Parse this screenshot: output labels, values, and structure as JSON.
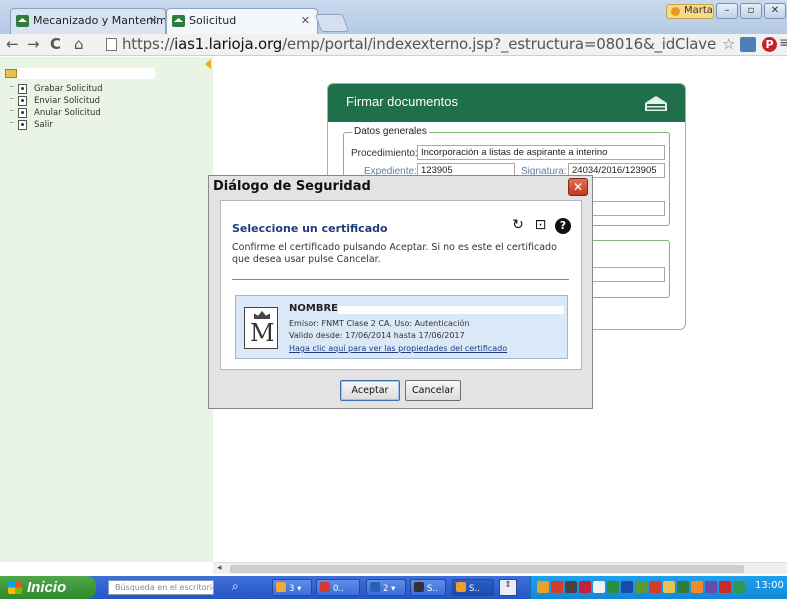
{
  "browser": {
    "tabs": [
      {
        "title": "Mecanizado y Mantenim",
        "active": false
      },
      {
        "title": "Solicitud",
        "active": true
      }
    ],
    "user_badge": "Marta",
    "window_controls": [
      "minimize",
      "maximize",
      "close"
    ],
    "url_prefix": "https://",
    "url_host": "ias1.larioja.org",
    "url_path": "/emp/portal/indexexterno.jsp?_estructura=08016&_idClave=2016|EDD|EXTRAC"
  },
  "sidebar": {
    "items": [
      {
        "label": "Grabar Solicitud"
      },
      {
        "label": "Enviar Solicitud"
      },
      {
        "label": "Anular Solicitud"
      },
      {
        "label": "Salir"
      }
    ]
  },
  "firmar": {
    "title": "Firmar documentos",
    "legend": "Datos generales",
    "procedimiento_label": "Procedimiento:",
    "procedimiento_value": "Incorporación a listas de aspirante a interino",
    "expediente_label": "Expediente:",
    "expediente_value": "123905",
    "signatura_label": "Signatura:",
    "signatura_value": "24034/2016/123905"
  },
  "dialog": {
    "title": "Diálogo de Seguridad",
    "heading": "Seleccione un certificado",
    "text": "Confirme el certificado pulsando Aceptar. Si no es este el certificado que desea usar pulse Cancelar.",
    "certificate": {
      "name": "NOMBRE",
      "issuer": "Emisor: FNMT Clase 2 CA. Uso: Autenticación",
      "validity": "Valido desde: 17/06/2014 hasta 17/06/2017",
      "link": "Haga clic aquí para ver las propiedades del certificado"
    },
    "accept_label": "Aceptar",
    "cancel_label": "Cancelar"
  },
  "taskbar": {
    "start_label": "Inicio",
    "search_placeholder": "Búsqueda en el escritorio",
    "buttons": [
      {
        "label": "3",
        "color": "#f2a83a"
      },
      {
        "label": "0..",
        "color": "#d13b2f"
      },
      {
        "label": "2",
        "color": "#2b5fb3"
      },
      {
        "label": "S..",
        "color": "#333333"
      },
      {
        "label": "S..",
        "color": "#e9a12b"
      }
    ],
    "clock": "13:00"
  },
  "colors": {
    "header_green": "#1e6f4a",
    "sidebar_bg": "#e9f4e4",
    "taskbar_blue": "#2455c6",
    "start_green": "#3d9a3a"
  }
}
